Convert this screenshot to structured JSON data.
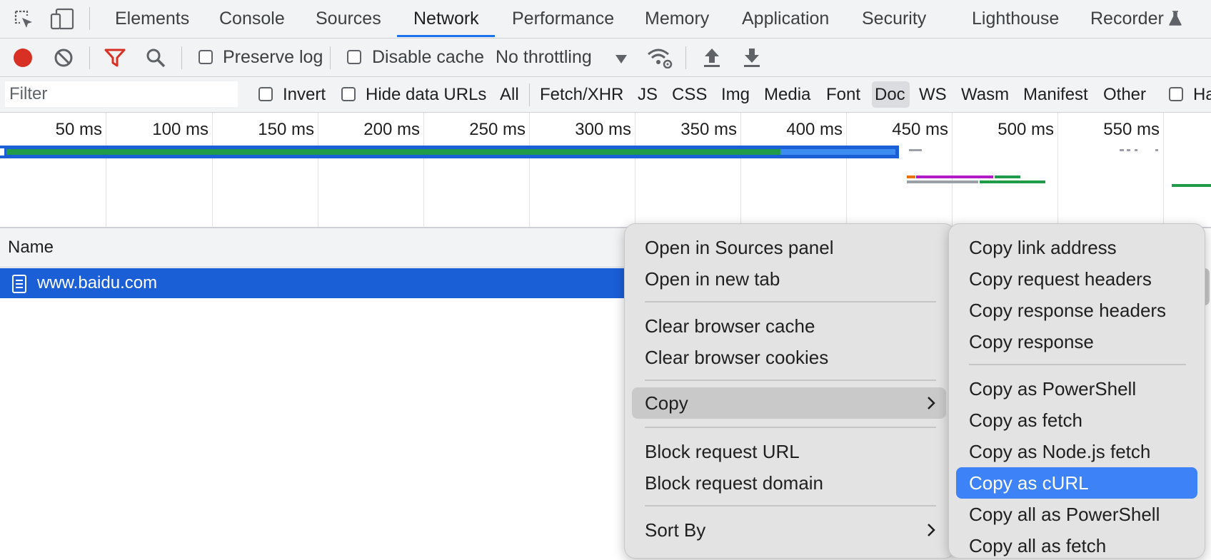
{
  "tabs": [
    {
      "label": "Elements"
    },
    {
      "label": "Console"
    },
    {
      "label": "Sources"
    },
    {
      "label": "Network",
      "active": true
    },
    {
      "label": "Performance"
    },
    {
      "label": "Memory"
    },
    {
      "label": "Application"
    },
    {
      "label": "Security"
    },
    {
      "label": "Lighthouse"
    },
    {
      "label": "Recorder"
    }
  ],
  "toolbar": {
    "preserve_log": "Preserve log",
    "disable_cache": "Disable cache",
    "throttling": "No throttling"
  },
  "filter": {
    "placeholder": "Filter",
    "invert": "Invert",
    "hide_data_urls": "Hide data URLs",
    "types": [
      "All",
      "Fetch/XHR",
      "JS",
      "CSS",
      "Img",
      "Media",
      "Font",
      "Doc",
      "WS",
      "Wasm",
      "Manifest",
      "Other"
    ],
    "active_type": "Doc",
    "trailing": "Ha"
  },
  "timeline": {
    "ticks": [
      "50 ms",
      "100 ms",
      "150 ms",
      "200 ms",
      "250 ms",
      "300 ms",
      "350 ms",
      "400 ms",
      "450 ms",
      "500 ms",
      "550 ms"
    ]
  },
  "table": {
    "header_name": "Name",
    "rows": [
      {
        "name": "www.baidu.com",
        "selected": true
      }
    ]
  },
  "context_menu": {
    "items": [
      "Open in Sources panel",
      "Open in new tab",
      "Clear browser cache",
      "Clear browser cookies",
      "Copy",
      "Block request URL",
      "Block request domain",
      "Sort By"
    ]
  },
  "copy_submenu": {
    "items": [
      "Copy link address",
      "Copy request headers",
      "Copy response headers",
      "Copy response",
      "Copy as PowerShell",
      "Copy as fetch",
      "Copy as Node.js fetch",
      "Copy as cURL",
      "Copy all as PowerShell",
      "Copy all as fetch"
    ],
    "highlighted": "Copy as cURL"
  },
  "colors": {
    "accent": "#1a73e8",
    "selection": "#1a5fd6",
    "record": "#d93025",
    "filter_icon": "#d93025",
    "menu_highlight": "#3d82f7"
  }
}
